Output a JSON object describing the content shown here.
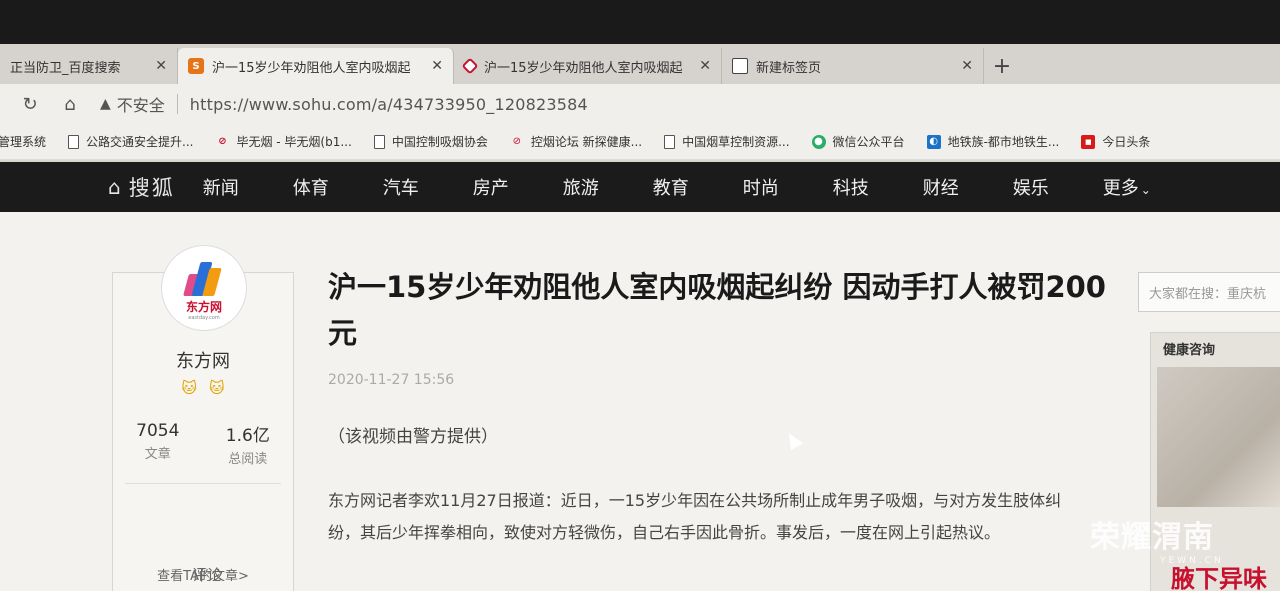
{
  "browser": {
    "tabs": [
      {
        "label": "正当防卫_百度搜索",
        "active": false
      },
      {
        "label": "沪一15岁少年劝阻他人室内吸烟起",
        "active": true
      },
      {
        "label": "沪一15岁少年劝阻他人室内吸烟起",
        "active": false
      },
      {
        "label": "新建标签页",
        "active": false
      }
    ],
    "security_label": "不安全",
    "url": "https://www.sohu.com/a/434733950_120823584",
    "bookmarks": [
      "管理系统",
      "公路交通安全提升...",
      "毕无烟 - 毕无烟(b1...",
      "中国控制吸烟协会",
      "控烟论坛 新探健康...",
      "中国烟草控制资源...",
      "微信公众平台",
      "地铁族-都市地铁生...",
      "今日头条"
    ]
  },
  "site": {
    "logo": "搜狐",
    "nav": [
      "新闻",
      "体育",
      "汽车",
      "房产",
      "旅游",
      "教育",
      "时尚",
      "科技",
      "财经",
      "娱乐",
      "更多"
    ]
  },
  "author": {
    "logo_text": "东方网",
    "logo_sub": "eastday.com",
    "name": "东方网",
    "badges": "🐱🐱",
    "articles_count": "7054",
    "articles_label": "文章",
    "reads_count": "1.6亿",
    "reads_label": "总阅读",
    "view_all": "查看TA的文章>",
    "comment": "评论"
  },
  "article": {
    "title": "沪一15岁少年劝阻他人室内吸烟起纠纷 因动手打人被罚200元",
    "date": "2020-11-27 15:56",
    "p1": "（该视频由警方提供）",
    "p2": "东方网记者李欢11月27日报道：近日，一15岁少年因在公共场所制止成年男子吸烟，与对方发生肢体纠纷，其后少年挥拳相向，致使对方轻微伤，自己右手因此骨折。事发后，一度在网上引起热议。"
  },
  "sidebar": {
    "search_placeholder": "大家都在搜：重庆杭",
    "ad_label": "健康咨询",
    "ad_text": "腋下异味"
  },
  "watermark": {
    "text": "荣耀渭南",
    "sub": "YEWN.CN"
  }
}
